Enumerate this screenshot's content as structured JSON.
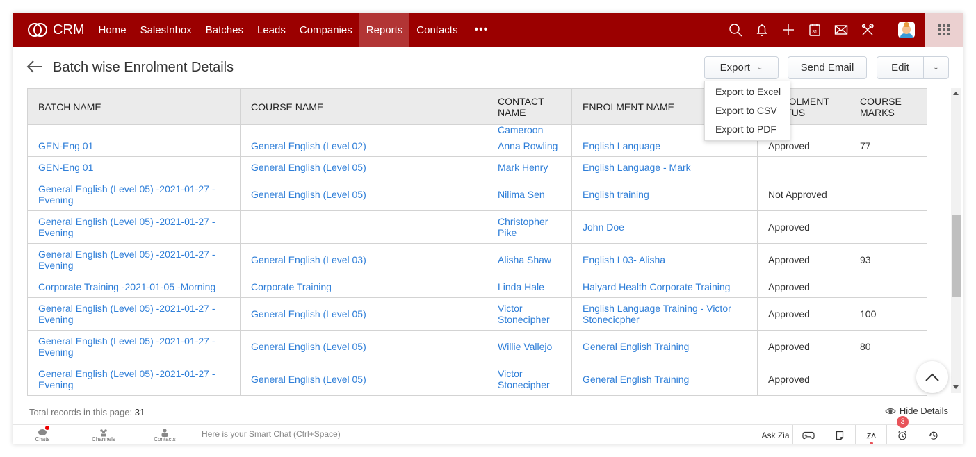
{
  "app": {
    "name": "CRM",
    "brand_color": "#9b0000",
    "active_nav_color": "#b23535",
    "link_color": "#2e7ed8"
  },
  "nav": {
    "items": [
      {
        "label": "Home",
        "active": false
      },
      {
        "label": "SalesInbox",
        "active": false
      },
      {
        "label": "Batches",
        "active": false
      },
      {
        "label": "Leads",
        "active": false
      },
      {
        "label": "Companies",
        "active": false
      },
      {
        "label": "Reports",
        "active": true
      },
      {
        "label": "Contacts",
        "active": false
      }
    ],
    "more_label": "•••",
    "icons": [
      "search-icon",
      "bell-icon",
      "plus-icon",
      "calendar-icon",
      "mail-icon",
      "tools-icon",
      "avatar",
      "apps-grid-icon"
    ],
    "calendar_day": "31"
  },
  "header": {
    "title": "Batch wise Enrolment Details",
    "export_label": "Export",
    "send_email_label": "Send Email",
    "edit_label": "Edit"
  },
  "export_menu": {
    "items": [
      "Export to Excel",
      "Export to CSV",
      "Export to PDF"
    ]
  },
  "table": {
    "columns": [
      "BATCH NAME",
      "COURSE NAME",
      "CONTACT NAME",
      "ENROLMENT NAME",
      "ENROLMENT STATUS",
      "COURSE MARKS"
    ],
    "partial_row_contact": "Cameroon",
    "rows": [
      {
        "batch": "GEN-Eng 01",
        "course": "General English (Level 02)",
        "contact": "Anna Rowling",
        "enrolment": "English Language",
        "status": "Approved",
        "marks": "77"
      },
      {
        "batch": "GEN-Eng 01",
        "course": "General English (Level 05)",
        "contact": "Mark Henry",
        "enrolment": "English Language - Mark",
        "status": "",
        "marks": ""
      },
      {
        "batch": "General English (Level 05) -2021-01-27 -Evening",
        "course": "General English (Level 05)",
        "contact": "Nilima Sen",
        "enrolment": "English training",
        "status": "Not Approved",
        "marks": ""
      },
      {
        "batch": "General English (Level 05) -2021-01-27 -Evening",
        "course": "",
        "contact": "Christopher Pike",
        "enrolment": "John Doe",
        "status": "Approved",
        "marks": ""
      },
      {
        "batch": "General English (Level 05) -2021-01-27 -Evening",
        "course": "General English (Level 03)",
        "contact": "Alisha Shaw",
        "enrolment": "English L03- Alisha",
        "status": "Approved",
        "marks": "93"
      },
      {
        "batch": "Corporate Training -2021-01-05 -Morning",
        "course": "Corporate Training",
        "contact": "Linda Hale",
        "enrolment": "Halyard Health Corporate Training",
        "status": "Approved",
        "marks": ""
      },
      {
        "batch": "General English (Level 05) -2021-01-27 -Evening",
        "course": "General English (Level 05)",
        "contact": "Victor Stonecipher",
        "enrolment": "English Language Training - Victor Stonecicpher",
        "status": "Approved",
        "marks": "100"
      },
      {
        "batch": "General English (Level 05) -2021-01-27 -Evening",
        "course": "General English (Level 05)",
        "contact": "Willie Vallejo",
        "enrolment": "General English Training",
        "status": "Approved",
        "marks": "80"
      },
      {
        "batch": "General English (Level 05) -2021-01-27 -Evening",
        "course": "General English (Level 05)",
        "contact": "Victor Stonecipher",
        "enrolment": "General English Training",
        "status": "Approved",
        "marks": ""
      }
    ]
  },
  "footer": {
    "total_label": "Total records in this page:",
    "total_value": "31",
    "hide_details_label": "Hide Details"
  },
  "chatbar": {
    "tabs": [
      "Chats",
      "Channels",
      "Contacts"
    ],
    "smart_chat_placeholder": "Here is your Smart Chat (Ctrl+Space)",
    "ask_zia_label": "Ask Zia",
    "reminder_badge": "3"
  }
}
